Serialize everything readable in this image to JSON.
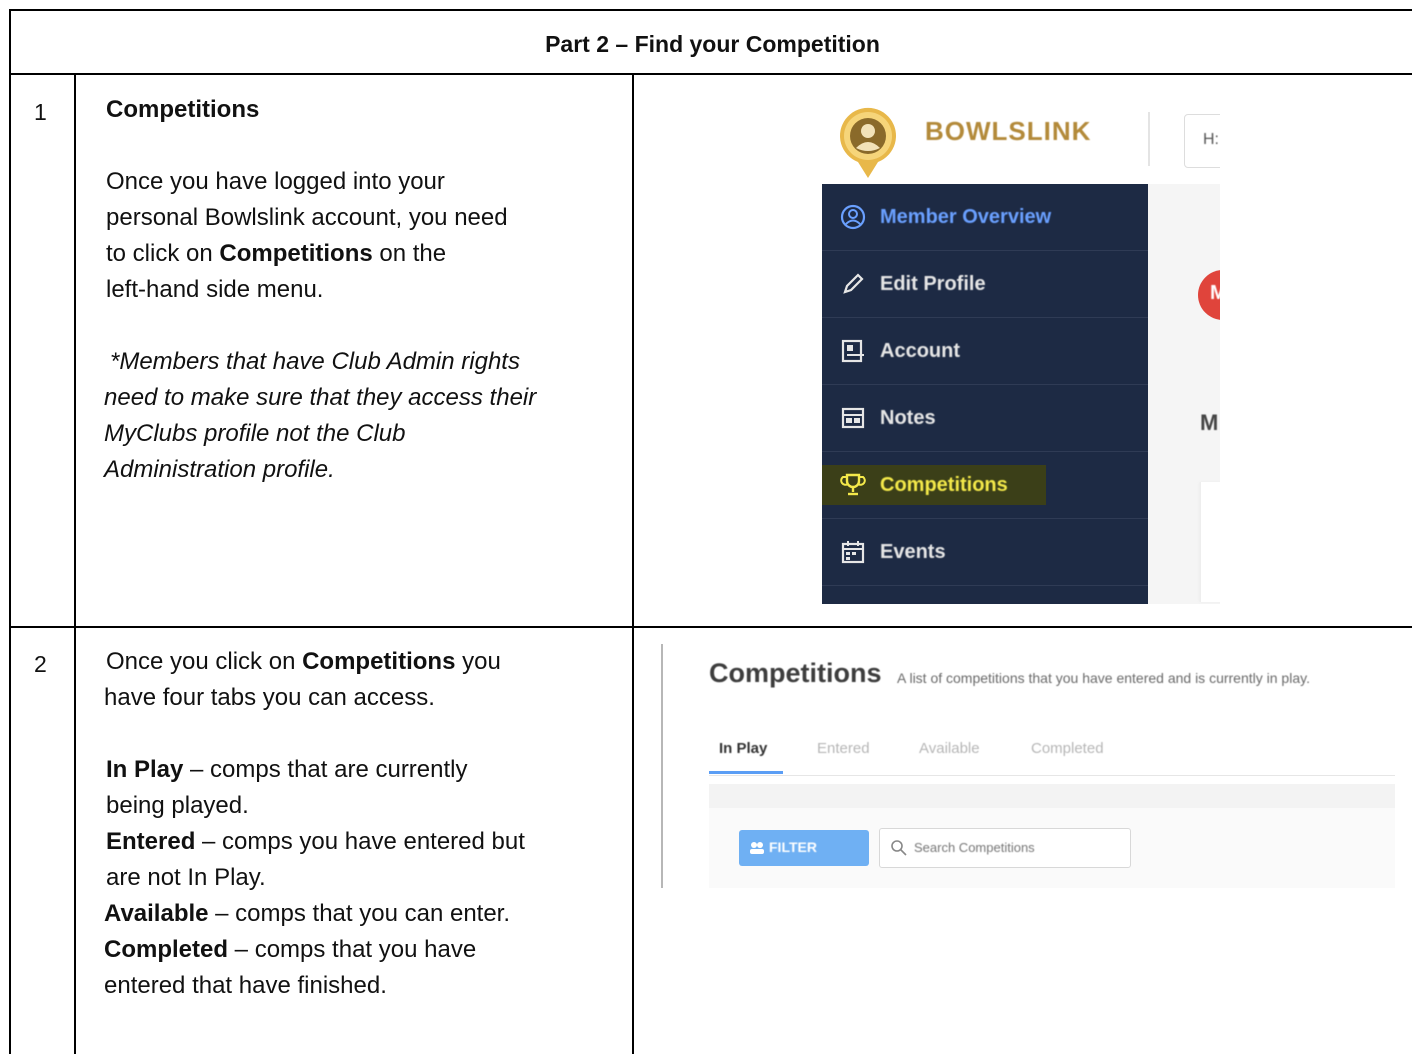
{
  "title": "Part 2 – Find your Competition",
  "rows": [
    {
      "number": "1",
      "heading": "Competitions",
      "para1": {
        "lines": [
          "Once you have logged into your",
          "personal Bowlslink account, you need",
          "to click on ",
          "Competitions",
          " on the",
          "left-hand side menu."
        ]
      },
      "note_lines": [
        "*Members that have Club Admin rights",
        "need to make sure that they access their",
        "MyClubs profile not the Club",
        "Administration profile."
      ]
    },
    {
      "number": "2",
      "intro_lines": [
        "Once you click on ",
        "Competitions",
        " you",
        "have four tabs you can access."
      ],
      "tabs": [
        {
          "name": "In Play",
          "desc1": " – comps that are currently",
          "desc2": "being played."
        },
        {
          "name": "Entered",
          "desc1": " – comps you have entered but",
          "desc2": "are not In Play."
        },
        {
          "name": "Available",
          "desc1": " – comps that you can enter.",
          "desc2": ""
        },
        {
          "name": "Completed",
          "desc1": " – comps that you have",
          "desc2": "entered that have finished."
        }
      ]
    }
  ],
  "screenshot1": {
    "brand": "BOWLSLINK",
    "search_fragment": "H:",
    "avatar_letter": "M",
    "side_letter": "M",
    "menu": [
      {
        "label": "Member Overview",
        "icon": "user-circle-icon",
        "state": "active"
      },
      {
        "label": "Edit Profile",
        "icon": "pencil-icon",
        "state": "normal"
      },
      {
        "label": "Account",
        "icon": "account-card-icon",
        "state": "normal"
      },
      {
        "label": "Notes",
        "icon": "notes-icon",
        "state": "normal"
      },
      {
        "label": "Competitions",
        "icon": "trophy-icon",
        "state": "highlight"
      },
      {
        "label": "Events",
        "icon": "calendar-icon",
        "state": "normal"
      }
    ]
  },
  "screenshot2": {
    "title": "Competitions",
    "subtitle": "A list of competitions that you have entered and is currently in play.",
    "tabs": [
      "In Play",
      "Entered",
      "Available",
      "Completed"
    ],
    "filter_label": "FILTER",
    "search_placeholder": "Search Competitions"
  }
}
